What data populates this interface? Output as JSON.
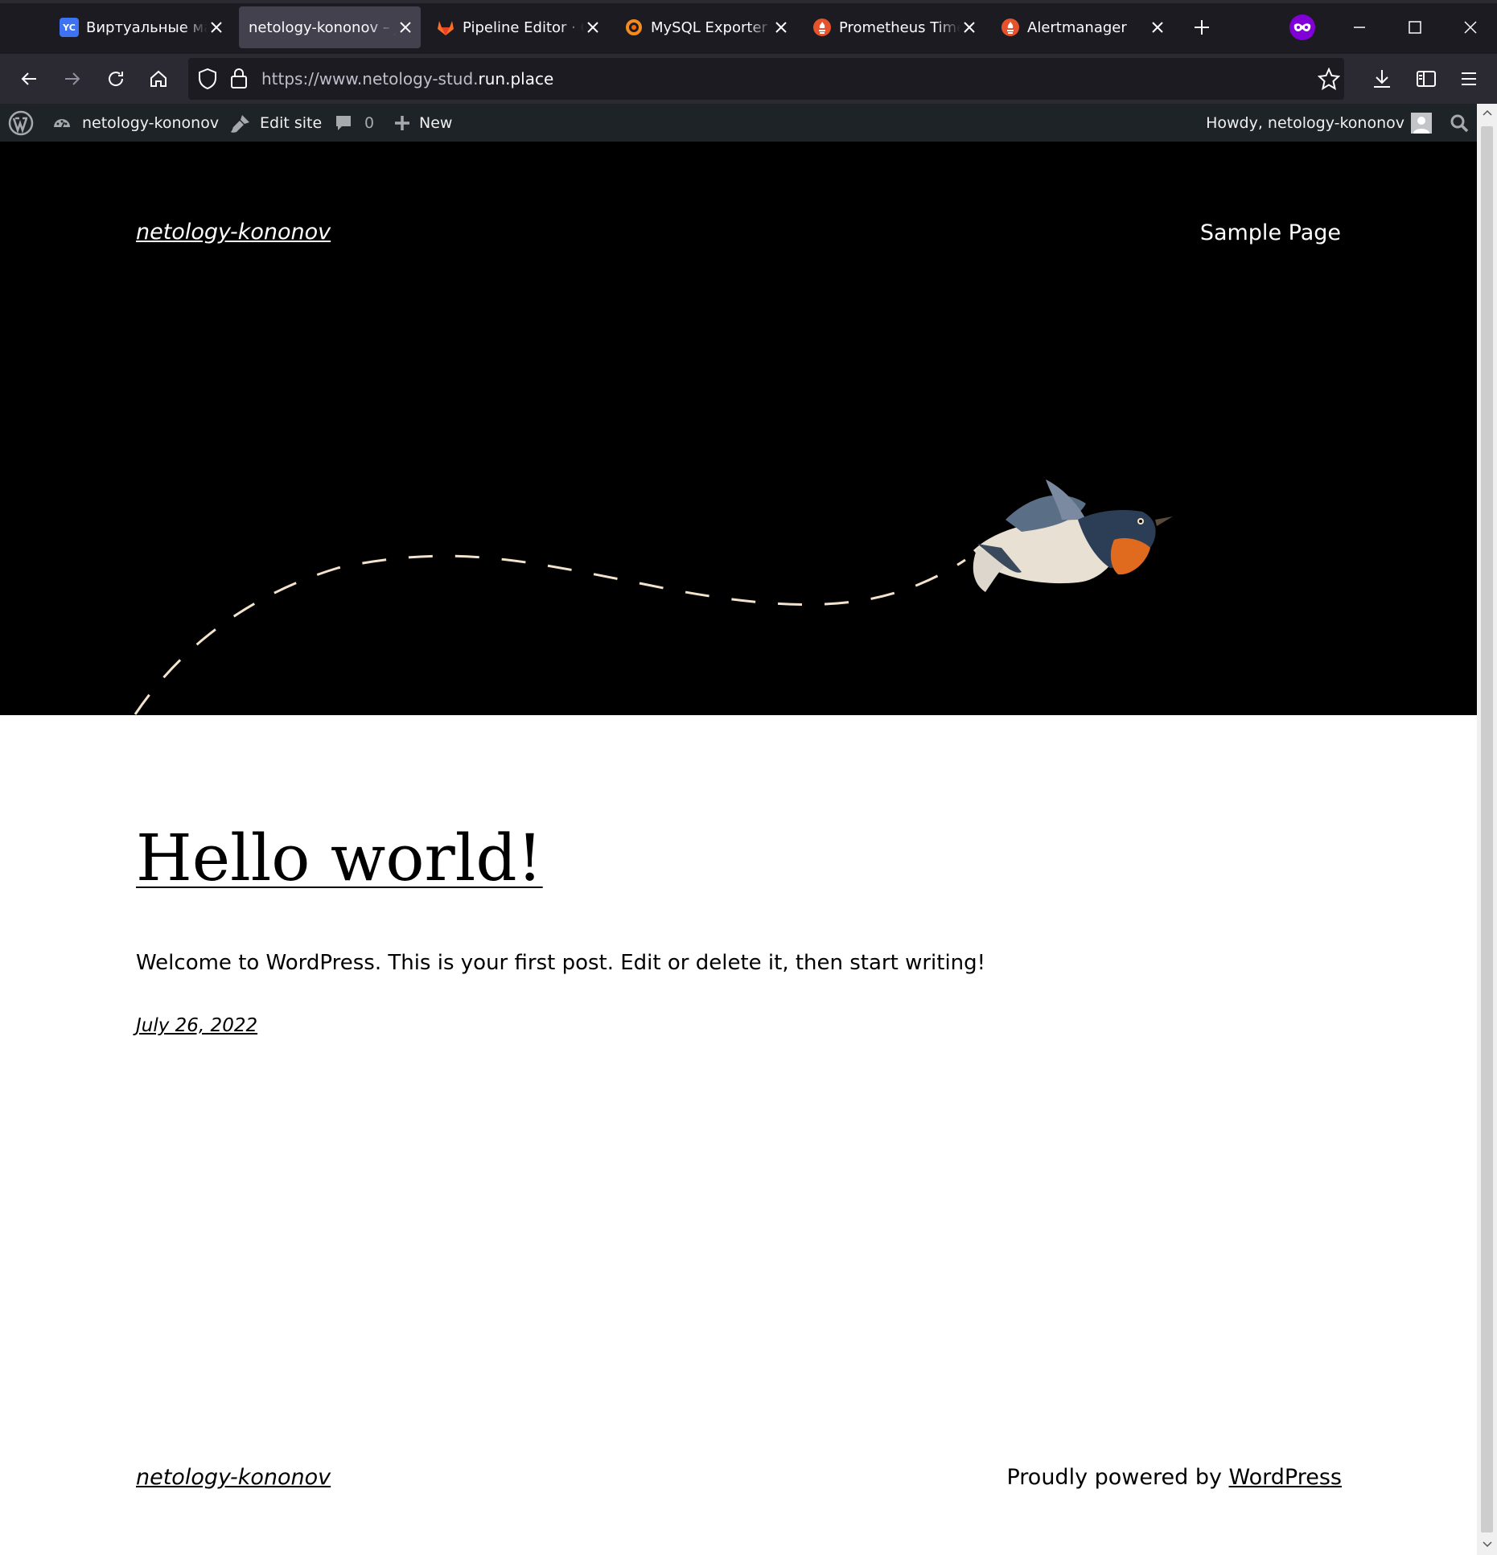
{
  "browser": {
    "tabs": [
      {
        "title": "Виртуальные машины",
        "favicon": "yc-icon",
        "favicon_text": "YC",
        "active": false
      },
      {
        "title": "netology-kononov – Just another WordPress site",
        "favicon": "",
        "active": true
      },
      {
        "title": "Pipeline Editor · GitLab",
        "favicon": "gitlab-icon",
        "active": false
      },
      {
        "title": "MySQL Exporter Quickstart",
        "favicon": "grafana-icon",
        "active": false
      },
      {
        "title": "Prometheus Time Series",
        "favicon": "prometheus-icon",
        "active": false
      },
      {
        "title": "Alertmanager",
        "favicon": "prometheus-icon",
        "active": false
      }
    ],
    "url_prefix": "https://www.netology-stud.",
    "url_domain": "run.place"
  },
  "adminbar": {
    "site_name": "netology-kononov",
    "edit_site": "Edit site",
    "comments_count": "0",
    "new_label": "New",
    "howdy": "Howdy, netology-kononov"
  },
  "page": {
    "site_title": "netology-kononov",
    "nav_item": "Sample Page",
    "post_title": "Hello world!",
    "post_body": "Welcome to WordPress. This is your first post. Edit or delete it, then start writing!",
    "post_date": "July 26, 2022",
    "footer_title": "netology-kononov",
    "footer_credit_prefix": "Proudly powered by ",
    "footer_credit_link": "WordPress"
  },
  "colors": {
    "tabbar": "#1c1b22",
    "navbar": "#2b2a33",
    "adminbar": "#1d2327",
    "hero_background": "#000000",
    "dash_line": "#f4e3cc"
  }
}
